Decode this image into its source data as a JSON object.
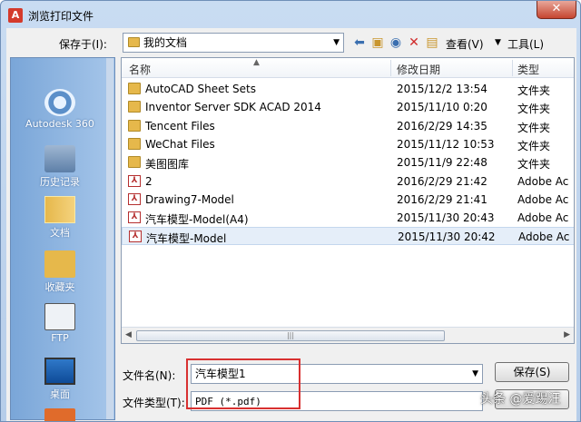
{
  "window": {
    "title": "浏览打印文件",
    "close_glyph": "✕"
  },
  "toolbar": {
    "save_in_label": "保存于(I):",
    "location": "我的文档",
    "view_label": "查看(V)",
    "tools_label": "工具(L)"
  },
  "places": [
    {
      "label": "Autodesk 360",
      "icon": "cloud-icon"
    },
    {
      "label": "历史记录",
      "icon": "history-icon"
    },
    {
      "label": "文档",
      "icon": "documents-icon"
    },
    {
      "label": "收藏夹",
      "icon": "favorites-icon"
    },
    {
      "label": "FTP",
      "icon": "ftp-icon"
    },
    {
      "label": "桌面",
      "icon": "desktop-icon"
    }
  ],
  "columns": {
    "name": "名称",
    "modified": "修改日期",
    "type": "类型"
  },
  "files": [
    {
      "name": "AutoCAD Sheet Sets",
      "date": "2015/12/2 13:54",
      "type": "文件夹",
      "kind": "folder"
    },
    {
      "name": "Inventor Server SDK ACAD 2014",
      "date": "2015/11/10 0:20",
      "type": "文件夹",
      "kind": "folder"
    },
    {
      "name": "Tencent Files",
      "date": "2016/2/29 14:35",
      "type": "文件夹",
      "kind": "folder"
    },
    {
      "name": "WeChat Files",
      "date": "2015/11/12 10:53",
      "type": "文件夹",
      "kind": "folder"
    },
    {
      "name": "美图图库",
      "date": "2015/11/9 22:48",
      "type": "文件夹",
      "kind": "folder"
    },
    {
      "name": "2",
      "date": "2016/2/29 21:42",
      "type": "Adobe Ac",
      "kind": "pdf"
    },
    {
      "name": "Drawing7-Model",
      "date": "2016/2/29 21:41",
      "type": "Adobe Ac",
      "kind": "pdf"
    },
    {
      "name": "汽车模型-Model(A4)",
      "date": "2015/11/30 20:43",
      "type": "Adobe Ac",
      "kind": "pdf"
    },
    {
      "name": "汽车模型-Model",
      "date": "2015/11/30 20:42",
      "type": "Adobe Ac",
      "kind": "pdf",
      "selected": true
    }
  ],
  "form": {
    "filename_label": "文件名(N):",
    "filename_value": "汽车模型1",
    "filetype_label": "文件类型(T):",
    "filetype_value": "PDF (*.pdf)"
  },
  "buttons": {
    "save": "保存(S)"
  },
  "watermark": "头条 @爱踢汪",
  "colors": {
    "highlight": "#d83030",
    "selection": "#e5eef9"
  }
}
